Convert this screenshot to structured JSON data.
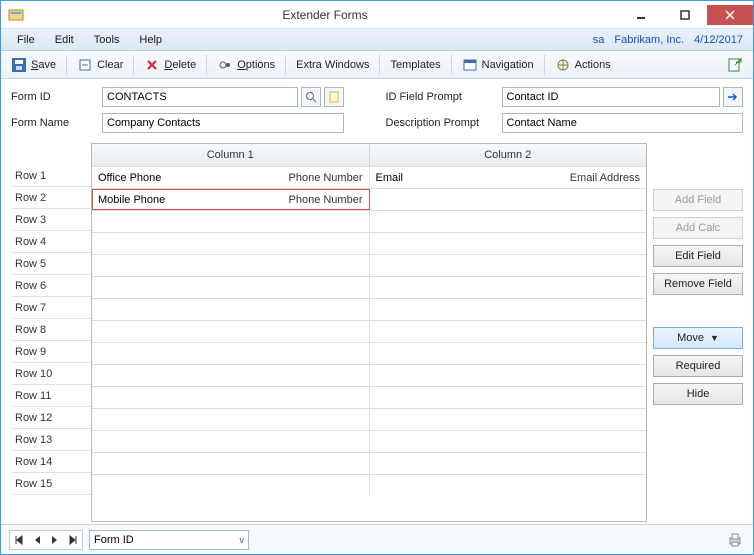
{
  "window": {
    "title": "Extender Forms"
  },
  "menu": {
    "file": "File",
    "edit": "Edit",
    "tools": "Tools",
    "help": "Help",
    "user": "sa",
    "company": "Fabrikam, Inc.",
    "date": "4/12/2017"
  },
  "toolbar": {
    "save": "Save",
    "clear": "Clear",
    "delete": "Delete",
    "options": "Options",
    "extra": "Extra Windows",
    "templates": "Templates",
    "navigation": "Navigation",
    "actions": "Actions"
  },
  "form": {
    "id_label": "Form ID",
    "id_value": "CONTACTS",
    "name_label": "Form Name",
    "name_value": "Company Contacts",
    "prompt_label": "ID Field Prompt",
    "prompt_value": "Contact ID",
    "desc_label": "Description Prompt",
    "desc_value": "Contact Name"
  },
  "grid": {
    "col1": "Column 1",
    "col2": "Column 2",
    "rows": [
      "Row 1",
      "Row 2",
      "Row 3",
      "Row 4",
      "Row 5",
      "Row 6",
      "Row 7",
      "Row 8",
      "Row 9",
      "Row 10",
      "Row 11",
      "Row 12",
      "Row 13",
      "Row 14",
      "Row 15"
    ],
    "cells": [
      {
        "c1l": "Office Phone",
        "c1r": "Phone Number",
        "c2l": "Email",
        "c2r": "Email Address"
      },
      {
        "c1l": "Mobile Phone",
        "c1r": "Phone Number",
        "c2l": "",
        "c2r": "",
        "selected": "c1"
      },
      {},
      {},
      {},
      {},
      {},
      {},
      {},
      {},
      {},
      {},
      {},
      {},
      {}
    ]
  },
  "buttons": {
    "add_field": "Add Field",
    "add_calc": "Add Calc",
    "edit_field": "Edit Field",
    "remove_field": "Remove Field",
    "move": "Move",
    "required": "Required",
    "hide": "Hide"
  },
  "footer": {
    "sort_field": "Form ID"
  }
}
